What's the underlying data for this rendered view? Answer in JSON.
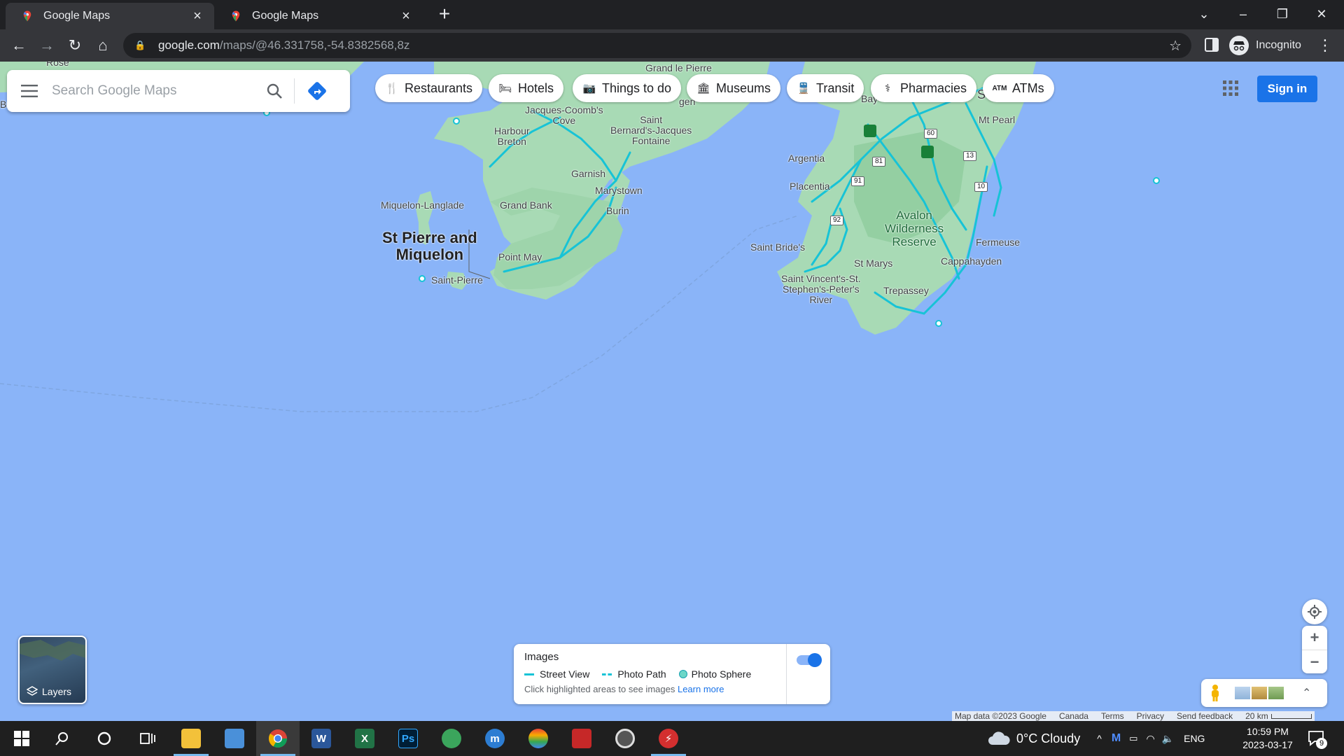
{
  "browser": {
    "tabs": [
      {
        "title": "Google Maps",
        "active": true
      },
      {
        "title": "Google Maps",
        "active": false
      }
    ],
    "url_host": "google.com",
    "url_path": "/maps/@46.331758,-54.8382568,8z",
    "profile_label": "Incognito"
  },
  "search": {
    "placeholder": "Search Google Maps"
  },
  "chips": [
    {
      "label": "Restaurants",
      "icon": "restaurant-icon"
    },
    {
      "label": "Hotels",
      "icon": "hotel-icon"
    },
    {
      "label": "Things to do",
      "icon": "camera-icon"
    },
    {
      "label": "Museums",
      "icon": "museum-icon"
    },
    {
      "label": "Transit",
      "icon": "transit-icon"
    },
    {
      "label": "Pharmacies",
      "icon": "pharmacy-icon"
    },
    {
      "label": "ATMs",
      "icon": "atm-icon"
    }
  ],
  "signin_label": "Sign in",
  "map_labels": {
    "rose": "Rose",
    "grand_le_pierre": "Grand le Pierre",
    "jacques": "Jacques-Coomb's\nCove",
    "harbour_breton": "Harbour\nBreton",
    "saint_bernards": "Saint\nBernard's-Jacques\nFontaine",
    "garnish": "Garnish",
    "marystown": "Marystown",
    "burin": "Burin",
    "grand_bank": "Grand Bank",
    "miquelon": "Miquelon-Langlade",
    "spm": "St Pierre and\nMiquelon",
    "point_may": "Point May",
    "saint_pierre": "Saint-Pierre",
    "argentia": "Argentia",
    "placentia": "Placentia",
    "saint_brides": "Saint Bride's",
    "avalon": "Avalon\nWilderness\nReserve",
    "fermeuse": "Fermeuse",
    "st_marys": "St Marys",
    "cappahayden": "Cappahayden",
    "svsp": "Saint Vincent's-St.\nStephen's-Peter's\nRiver",
    "trepassey": "Trepassey",
    "mt_pearl": "Mt Pearl",
    "bay": "Bay",
    "s": "S",
    "bu": "Bu",
    "gen": "gen"
  },
  "route_shields": [
    "60",
    "81",
    "91",
    "92",
    "13",
    "10"
  ],
  "layers_label": "Layers",
  "images_panel": {
    "title": "Images",
    "legend": [
      "Street View",
      "Photo Path",
      "Photo Sphere"
    ],
    "hint": "Click highlighted areas to see images",
    "learn_more": "Learn more",
    "toggle_on": true
  },
  "footer": {
    "map_data": "Map data ©2023 Google",
    "region": "Canada",
    "terms": "Terms",
    "privacy": "Privacy",
    "feedback": "Send feedback",
    "scale": "20 km"
  },
  "taskbar": {
    "weather": "0°C  Cloudy",
    "lang": "ENG",
    "time": "10:59 PM",
    "date": "2023-03-17",
    "notif_count": "9"
  },
  "colors": {
    "water": "#8ab4f8",
    "land": "#a8dab5",
    "road": "#17c3d6",
    "accent": "#1a73e8"
  }
}
